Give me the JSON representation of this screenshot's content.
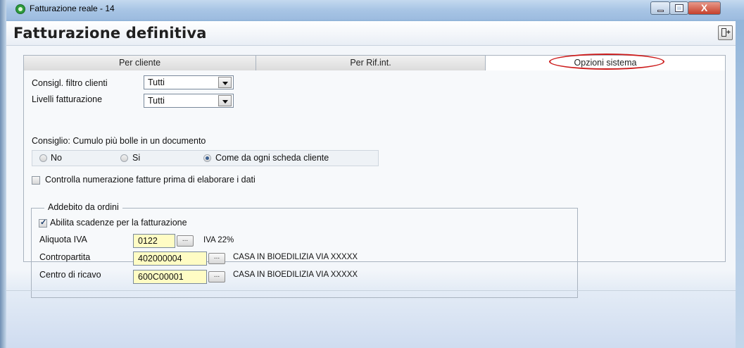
{
  "window": {
    "title": "Fatturazione reale - 14",
    "close_symbol": "X"
  },
  "header": {
    "title": "Fatturazione definitiva"
  },
  "tabs": [
    {
      "label": "Per cliente"
    },
    {
      "label": "Per Rif.int."
    },
    {
      "label": "Opzioni sistema",
      "selected": true
    }
  ],
  "options": {
    "filtro_clienti_label": "Consigl. filtro clienti",
    "filtro_clienti_value": "Tutti",
    "livelli_label": "Livelli fatturazione",
    "livelli_value": "Tutti",
    "cumulo_label": "Consiglio: Cumulo più bolle in un documento",
    "radio_options": [
      {
        "label": "No",
        "selected": false
      },
      {
        "label": "Si",
        "selected": false
      },
      {
        "label": "Come da ogni scheda cliente",
        "selected": true
      }
    ],
    "controlla_label": "Controlla numerazione fatture prima di elaborare i dati",
    "controlla_checked": false
  },
  "addebito": {
    "title": "Addebito da ordini",
    "abilita_label": "Abilita scadenze per la fatturazione",
    "abilita_checked": true,
    "aliquota_label": "Aliquota IVA",
    "aliquota_value": "0122",
    "aliquota_desc": "IVA 22%",
    "contropartita_label": "Contropartita",
    "contropartita_value": "402000004",
    "contropartita_desc": "CASA IN BIOEDILIZIA VIA XXXXX",
    "centro_label": "Centro di ricavo",
    "centro_value": "600C00001",
    "centro_desc": "CASA IN BIOEDILIZIA VIA XXXXX",
    "browse_label": "..."
  },
  "colors": {
    "field_bg": "#fffcc4",
    "highlight_circle": "#cc1b1b",
    "close_button": "#c6402b"
  }
}
